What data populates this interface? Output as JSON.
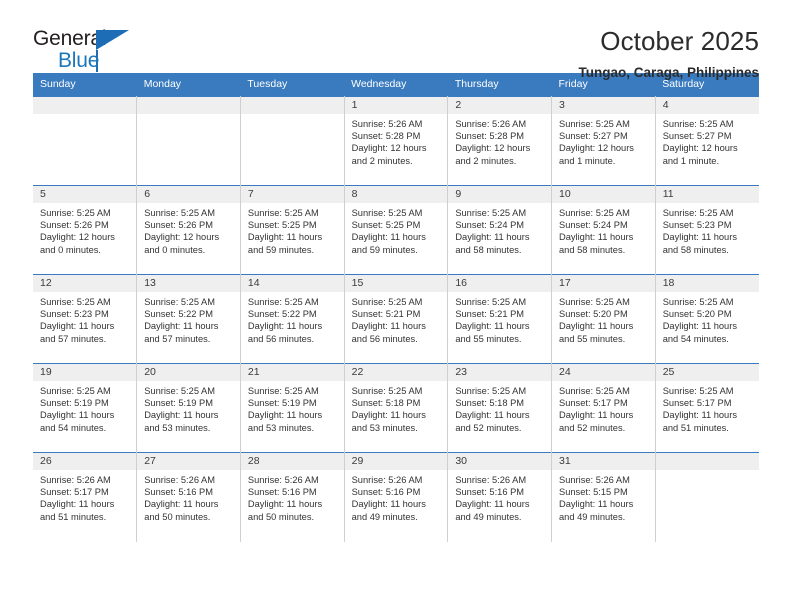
{
  "brand": {
    "name_top": "General",
    "name_bottom": "Blue",
    "color_dark": "#231f20",
    "color_blue": "#1c76bc"
  },
  "header": {
    "title": "October 2025",
    "subtitle": "Tungao, Caraga, Philippines"
  },
  "theme": {
    "header_bg": "#3a7bbf",
    "daynum_bg": "#efefef",
    "grid_line": "#cfcfcf"
  },
  "weekday_headers": [
    "Sunday",
    "Monday",
    "Tuesday",
    "Wednesday",
    "Thursday",
    "Friday",
    "Saturday"
  ],
  "labels": {
    "sunrise_prefix": "Sunrise:",
    "sunset_prefix": "Sunset:",
    "daylight_prefix": "Daylight:"
  },
  "weeks": [
    [
      {
        "day": "",
        "lines": []
      },
      {
        "day": "",
        "lines": []
      },
      {
        "day": "",
        "lines": []
      },
      {
        "day": "1",
        "lines": [
          "Sunrise: 5:26 AM",
          "Sunset: 5:28 PM",
          "Daylight: 12 hours",
          "and 2 minutes."
        ]
      },
      {
        "day": "2",
        "lines": [
          "Sunrise: 5:26 AM",
          "Sunset: 5:28 PM",
          "Daylight: 12 hours",
          "and 2 minutes."
        ]
      },
      {
        "day": "3",
        "lines": [
          "Sunrise: 5:25 AM",
          "Sunset: 5:27 PM",
          "Daylight: 12 hours",
          "and 1 minute."
        ]
      },
      {
        "day": "4",
        "lines": [
          "Sunrise: 5:25 AM",
          "Sunset: 5:27 PM",
          "Daylight: 12 hours",
          "and 1 minute."
        ]
      }
    ],
    [
      {
        "day": "5",
        "lines": [
          "Sunrise: 5:25 AM",
          "Sunset: 5:26 PM",
          "Daylight: 12 hours",
          "and 0 minutes."
        ]
      },
      {
        "day": "6",
        "lines": [
          "Sunrise: 5:25 AM",
          "Sunset: 5:26 PM",
          "Daylight: 12 hours",
          "and 0 minutes."
        ]
      },
      {
        "day": "7",
        "lines": [
          "Sunrise: 5:25 AM",
          "Sunset: 5:25 PM",
          "Daylight: 11 hours",
          "and 59 minutes."
        ]
      },
      {
        "day": "8",
        "lines": [
          "Sunrise: 5:25 AM",
          "Sunset: 5:25 PM",
          "Daylight: 11 hours",
          "and 59 minutes."
        ]
      },
      {
        "day": "9",
        "lines": [
          "Sunrise: 5:25 AM",
          "Sunset: 5:24 PM",
          "Daylight: 11 hours",
          "and 58 minutes."
        ]
      },
      {
        "day": "10",
        "lines": [
          "Sunrise: 5:25 AM",
          "Sunset: 5:24 PM",
          "Daylight: 11 hours",
          "and 58 minutes."
        ]
      },
      {
        "day": "11",
        "lines": [
          "Sunrise: 5:25 AM",
          "Sunset: 5:23 PM",
          "Daylight: 11 hours",
          "and 58 minutes."
        ]
      }
    ],
    [
      {
        "day": "12",
        "lines": [
          "Sunrise: 5:25 AM",
          "Sunset: 5:23 PM",
          "Daylight: 11 hours",
          "and 57 minutes."
        ]
      },
      {
        "day": "13",
        "lines": [
          "Sunrise: 5:25 AM",
          "Sunset: 5:22 PM",
          "Daylight: 11 hours",
          "and 57 minutes."
        ]
      },
      {
        "day": "14",
        "lines": [
          "Sunrise: 5:25 AM",
          "Sunset: 5:22 PM",
          "Daylight: 11 hours",
          "and 56 minutes."
        ]
      },
      {
        "day": "15",
        "lines": [
          "Sunrise: 5:25 AM",
          "Sunset: 5:21 PM",
          "Daylight: 11 hours",
          "and 56 minutes."
        ]
      },
      {
        "day": "16",
        "lines": [
          "Sunrise: 5:25 AM",
          "Sunset: 5:21 PM",
          "Daylight: 11 hours",
          "and 55 minutes."
        ]
      },
      {
        "day": "17",
        "lines": [
          "Sunrise: 5:25 AM",
          "Sunset: 5:20 PM",
          "Daylight: 11 hours",
          "and 55 minutes."
        ]
      },
      {
        "day": "18",
        "lines": [
          "Sunrise: 5:25 AM",
          "Sunset: 5:20 PM",
          "Daylight: 11 hours",
          "and 54 minutes."
        ]
      }
    ],
    [
      {
        "day": "19",
        "lines": [
          "Sunrise: 5:25 AM",
          "Sunset: 5:19 PM",
          "Daylight: 11 hours",
          "and 54 minutes."
        ]
      },
      {
        "day": "20",
        "lines": [
          "Sunrise: 5:25 AM",
          "Sunset: 5:19 PM",
          "Daylight: 11 hours",
          "and 53 minutes."
        ]
      },
      {
        "day": "21",
        "lines": [
          "Sunrise: 5:25 AM",
          "Sunset: 5:19 PM",
          "Daylight: 11 hours",
          "and 53 minutes."
        ]
      },
      {
        "day": "22",
        "lines": [
          "Sunrise: 5:25 AM",
          "Sunset: 5:18 PM",
          "Daylight: 11 hours",
          "and 53 minutes."
        ]
      },
      {
        "day": "23",
        "lines": [
          "Sunrise: 5:25 AM",
          "Sunset: 5:18 PM",
          "Daylight: 11 hours",
          "and 52 minutes."
        ]
      },
      {
        "day": "24",
        "lines": [
          "Sunrise: 5:25 AM",
          "Sunset: 5:17 PM",
          "Daylight: 11 hours",
          "and 52 minutes."
        ]
      },
      {
        "day": "25",
        "lines": [
          "Sunrise: 5:25 AM",
          "Sunset: 5:17 PM",
          "Daylight: 11 hours",
          "and 51 minutes."
        ]
      }
    ],
    [
      {
        "day": "26",
        "lines": [
          "Sunrise: 5:26 AM",
          "Sunset: 5:17 PM",
          "Daylight: 11 hours",
          "and 51 minutes."
        ]
      },
      {
        "day": "27",
        "lines": [
          "Sunrise: 5:26 AM",
          "Sunset: 5:16 PM",
          "Daylight: 11 hours",
          "and 50 minutes."
        ]
      },
      {
        "day": "28",
        "lines": [
          "Sunrise: 5:26 AM",
          "Sunset: 5:16 PM",
          "Daylight: 11 hours",
          "and 50 minutes."
        ]
      },
      {
        "day": "29",
        "lines": [
          "Sunrise: 5:26 AM",
          "Sunset: 5:16 PM",
          "Daylight: 11 hours",
          "and 49 minutes."
        ]
      },
      {
        "day": "30",
        "lines": [
          "Sunrise: 5:26 AM",
          "Sunset: 5:16 PM",
          "Daylight: 11 hours",
          "and 49 minutes."
        ]
      },
      {
        "day": "31",
        "lines": [
          "Sunrise: 5:26 AM",
          "Sunset: 5:15 PM",
          "Daylight: 11 hours",
          "and 49 minutes."
        ]
      },
      {
        "day": "",
        "lines": []
      }
    ]
  ]
}
